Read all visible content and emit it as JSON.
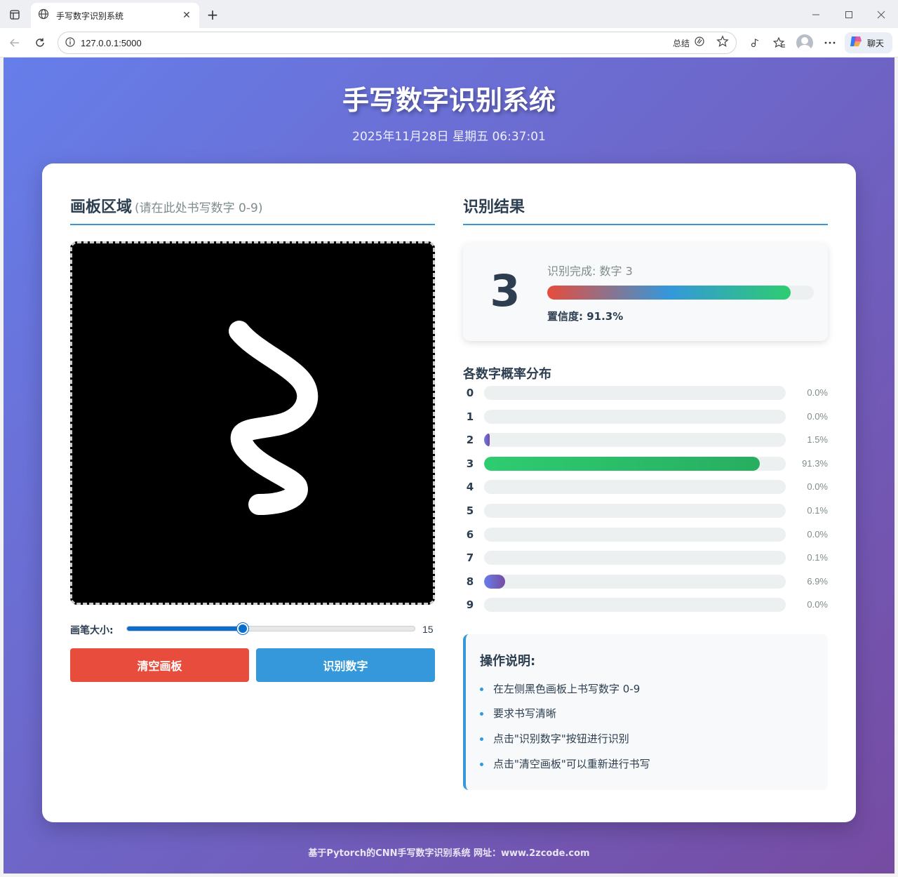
{
  "browser": {
    "tab_title": "手写数字识别系统",
    "tab_close": "✕",
    "new_tab": "+",
    "url": "127.0.0.1:5000",
    "summary_label": "总结",
    "chat_label": "聊天"
  },
  "header": {
    "title": "手写数字识别系统",
    "datetime": "2025年11月28日 星期五 06:37:01"
  },
  "canvas_panel": {
    "title": "画板区域",
    "subtitle": "(请在此处书写数字 0-9)",
    "brush_label": "画笔大小:",
    "brush_value": "15",
    "brush_level": 0.4,
    "clear_button": "清空画板",
    "recognize_button": "识别数字"
  },
  "result_panel": {
    "title": "识别结果",
    "digit": "3",
    "message": "识别完成: 数字 3",
    "confidence_text": "置信度: 91.3%",
    "confidence": 91.3,
    "distribution_title": "各数字概率分布",
    "probabilities": [
      {
        "digit": "0",
        "label": "0.0%",
        "value": 0.0
      },
      {
        "digit": "1",
        "label": "0.0%",
        "value": 0.0
      },
      {
        "digit": "2",
        "label": "1.5%",
        "value": 1.5
      },
      {
        "digit": "3",
        "label": "91.3%",
        "value": 91.3
      },
      {
        "digit": "4",
        "label": "0.0%",
        "value": 0.0
      },
      {
        "digit": "5",
        "label": "0.1%",
        "value": 0.1
      },
      {
        "digit": "6",
        "label": "0.0%",
        "value": 0.0
      },
      {
        "digit": "7",
        "label": "0.1%",
        "value": 0.1
      },
      {
        "digit": "8",
        "label": "6.9%",
        "value": 6.9
      },
      {
        "digit": "9",
        "label": "0.0%",
        "value": 0.0
      }
    ]
  },
  "instructions": {
    "title": "操作说明:",
    "items": [
      "在左侧黑色画板上书写数字 0-9",
      "要求书写清晰",
      "点击\"识别数字\"按钮进行识别",
      "点击\"清空画板\"可以重新进行书写"
    ]
  },
  "footer": "基于Pytorch的CNN手写数字识别系统 网址：www.2zcode.com",
  "colors": {
    "accent": "#3498db",
    "clear_button": "#e74c3c",
    "recognize_button": "#3498db",
    "top_prob": "#2ecc71",
    "other_prob": "#764ba2"
  }
}
